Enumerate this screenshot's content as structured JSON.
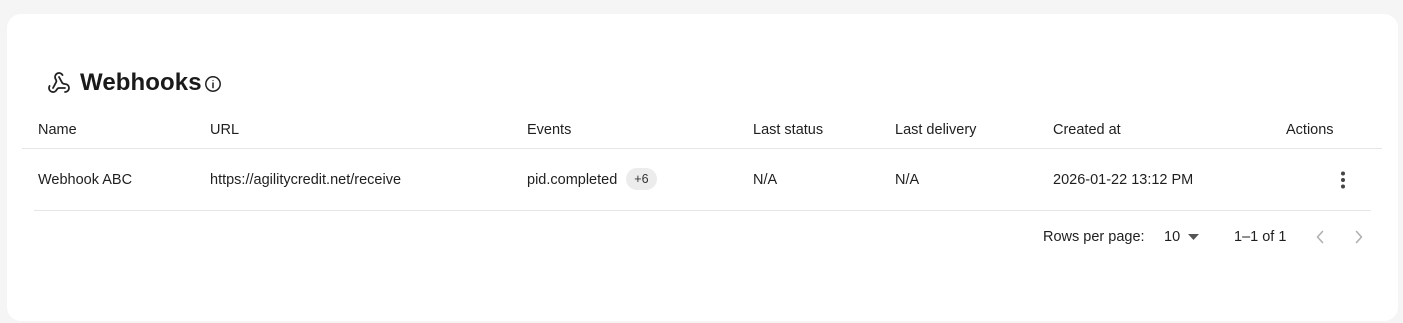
{
  "page": {
    "title": "Webhooks",
    "title_icon": "webhook-icon",
    "info_icon": "info-icon"
  },
  "table": {
    "columns": [
      "Name",
      "URL",
      "Events",
      "Last status",
      "Last delivery",
      "Created at",
      "Actions"
    ],
    "rows": [
      {
        "name": "Webhook ABC",
        "url": "https://agilitycredit.net/receive",
        "event": "pid.completed",
        "more_events": "+6",
        "last_status": "N/A",
        "last_delivery": "N/A",
        "created_at": "2026-01-22 13:12 PM",
        "actions_icon": "more-vertical-icon"
      }
    ]
  },
  "pagination": {
    "rows_per_page_label": "Rows per page:",
    "rows_per_page_value": "10",
    "range": "1–1 of 1",
    "prev_icon": "chevron-left-icon",
    "next_icon": "chevron-right-icon"
  },
  "colors": {
    "background": "#f5f5f5",
    "card": "#ffffff",
    "divider": "#e6e6e6",
    "badge_bg": "#ececec",
    "disabled_nav": "#b0b0b0"
  }
}
